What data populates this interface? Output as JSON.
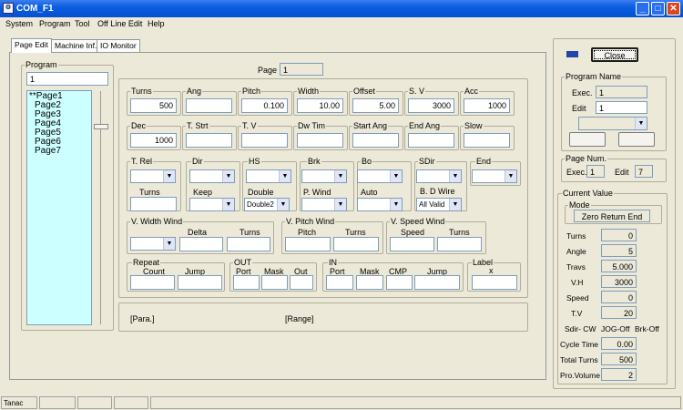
{
  "window": {
    "title": "COM_F1",
    "icon": "app-icon",
    "minimize": "_",
    "maximize": "□",
    "close": "✕"
  },
  "menu": [
    "System",
    "Program",
    "Tool",
    "Off Line Edit",
    "Help"
  ],
  "tabs": [
    "Page Edit",
    "Machine Inf.",
    "IO Monitor"
  ],
  "program": {
    "label": "Program",
    "value": "1",
    "pages": [
      "**Page1",
      "Page2",
      "Page3",
      "Page4",
      "Page5",
      "Page6",
      "Page7"
    ]
  },
  "page": {
    "label": "Page",
    "value": "1"
  },
  "row1": [
    {
      "label": "Turns",
      "value": "500"
    },
    {
      "label": "Ang",
      "value": ""
    },
    {
      "label": "Pitch",
      "value": "0.100"
    },
    {
      "label": "Width",
      "value": "10.00"
    },
    {
      "label": "Offset",
      "value": "5.00"
    },
    {
      "label": "S. V",
      "value": "3000"
    },
    {
      "label": "Acc",
      "value": "1000"
    }
  ],
  "row2": [
    {
      "label": "Dec",
      "value": "1000"
    },
    {
      "label": "T. Strt",
      "value": ""
    },
    {
      "label": "T. V",
      "value": ""
    },
    {
      "label": "Dw Tim",
      "value": ""
    },
    {
      "label": "Start Ang",
      "value": ""
    },
    {
      "label": "End Ang",
      "value": ""
    },
    {
      "label": "Slow",
      "value": ""
    }
  ],
  "row3": [
    {
      "label": "T. Rel",
      "value": ""
    },
    {
      "label": "Dir",
      "value": ""
    },
    {
      "label": "HS",
      "value": ""
    },
    {
      "label": "Brk",
      "value": ""
    },
    {
      "label": "Bo",
      "value": ""
    },
    {
      "label": "SDir",
      "value": ""
    },
    {
      "label": "End",
      "value": ""
    }
  ],
  "row4": {
    "turns_label": "Turns",
    "keep_label": "Keep",
    "double_label": "Double",
    "double_value": "Double2",
    "pwind_label": "P. Wind",
    "auto_label": "Auto",
    "bdwire_label": "B. D Wire",
    "bdwire_value": "All Valid"
  },
  "vwidth": {
    "label": "V. Width Wind",
    "delta": "Delta",
    "turns": "Turns"
  },
  "vpitch": {
    "label": "V. Pitch Wind",
    "pitch": "Pitch",
    "turns": "Turns"
  },
  "vspeed": {
    "label": "V. Speed Wind",
    "speed": "Speed",
    "turns": "Turns"
  },
  "repeat": {
    "label": "Repeat",
    "count": "Count",
    "jump": "Jump"
  },
  "out": {
    "label": "OUT",
    "port": "Port",
    "mask": "Mask",
    "out": "Out"
  },
  "in": {
    "label": "IN",
    "port": "Port",
    "mask": "Mask",
    "cmp": "CMP",
    "jump": "Jump"
  },
  "labelgrp": {
    "label": "Label",
    "x": "x"
  },
  "bottom": {
    "para": "[Para.]",
    "range": "[Range]"
  },
  "right": {
    "close": "Close",
    "progname": "Program Name",
    "exec_label": "Exec.",
    "exec_value": "1",
    "edit_label": "Edit",
    "edit_value": "1",
    "pagenum": "Page Num.",
    "pn_exec_label": "Exec.",
    "pn_exec_value": "1",
    "pn_edit_label": "Edit",
    "pn_edit_value": "7",
    "current": "Current Value",
    "mode_label": "Mode",
    "mode_value": "Zero Return End"
  },
  "current": [
    {
      "label": "Turns",
      "value": "0"
    },
    {
      "label": "Angle",
      "value": "5"
    },
    {
      "label": "Travs",
      "value": "5.000"
    },
    {
      "label": "V.H",
      "value": "3000"
    },
    {
      "label": "Speed",
      "value": "0"
    },
    {
      "label": "T.V",
      "value": "20"
    }
  ],
  "status_line": {
    "sdir": "Sdir- CW",
    "jog": "JOG-Off",
    "brk": "Brk-Off"
  },
  "current2": [
    {
      "label": "Cycle Time",
      "value": "0.00"
    },
    {
      "label": "Total Turns",
      "value": "500"
    },
    {
      "label": "Pro.Volume",
      "value": "2"
    }
  ],
  "statusbar": {
    "text": "Tanac"
  }
}
